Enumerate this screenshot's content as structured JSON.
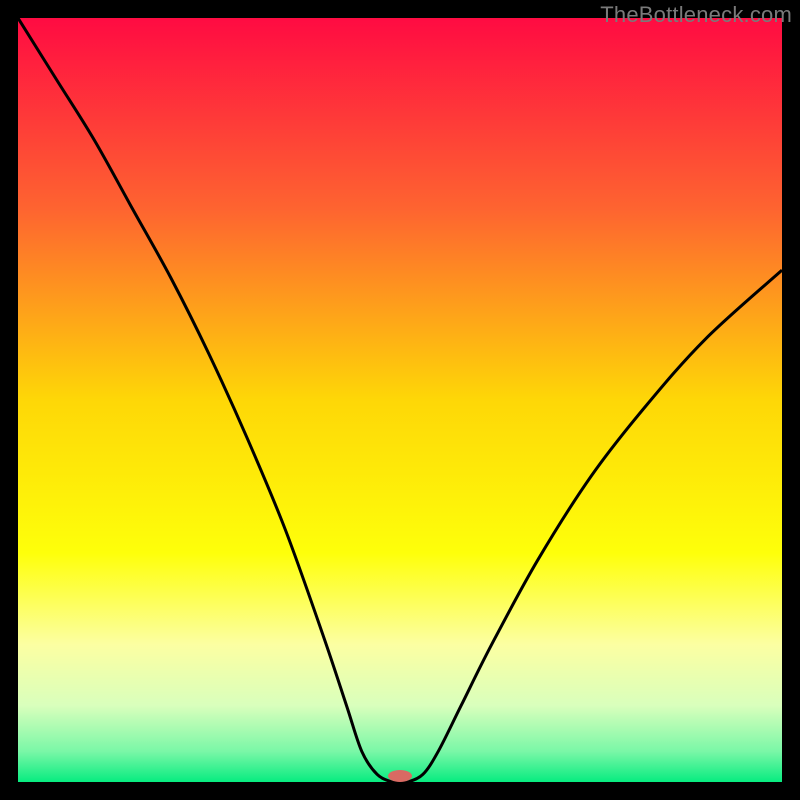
{
  "watermark": "TheBottleneck.com",
  "chart_data": {
    "type": "line",
    "title": "",
    "xlabel": "",
    "ylabel": "",
    "xlim": [
      0,
      100
    ],
    "ylim": [
      0,
      100
    ],
    "background_gradient": {
      "stops": [
        {
          "pos": 0.0,
          "color": "#ff0b42"
        },
        {
          "pos": 0.25,
          "color": "#fe6430"
        },
        {
          "pos": 0.5,
          "color": "#fed707"
        },
        {
          "pos": 0.7,
          "color": "#feff0a"
        },
        {
          "pos": 0.82,
          "color": "#fcffa2"
        },
        {
          "pos": 0.9,
          "color": "#d9ffbc"
        },
        {
          "pos": 0.96,
          "color": "#7af7a7"
        },
        {
          "pos": 1.0,
          "color": "#07ec80"
        }
      ]
    },
    "series": [
      {
        "name": "bottleneck-curve",
        "color": "#000000",
        "x": [
          0,
          5,
          10,
          15,
          20,
          25,
          30,
          35,
          40,
          43,
          45,
          47,
          49,
          50,
          51,
          53,
          55,
          58,
          62,
          68,
          75,
          82,
          90,
          100
        ],
        "y": [
          100,
          92,
          84,
          75,
          66,
          56,
          45,
          33,
          19,
          10,
          4,
          1,
          0,
          0,
          0,
          1,
          4,
          10,
          18,
          29,
          40,
          49,
          58,
          67
        ]
      }
    ],
    "marker": {
      "name": "optimal-point",
      "x": 50,
      "y": 0,
      "color": "#d96a63",
      "rx": 12,
      "ry": 6
    }
  }
}
